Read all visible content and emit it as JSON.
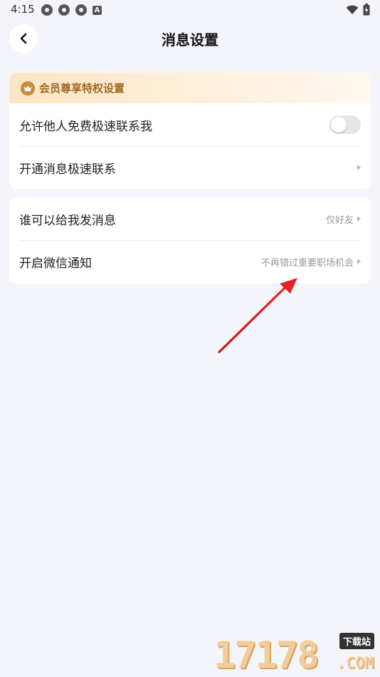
{
  "status_bar": {
    "time": "4:15",
    "left_icons": [
      "vpn-icon",
      "vpn-icon",
      "vpn-icon",
      "a-icon"
    ],
    "a_glyph": "A",
    "right_icons": [
      "wifi-icon",
      "battery-icon"
    ]
  },
  "header": {
    "title": "消息设置",
    "back_icon": "chevron-left-icon"
  },
  "vip_section": {
    "title": "会员尊享特权设置",
    "icon": "crown-icon",
    "accent_color": "#a0661f",
    "rows": [
      {
        "label": "允许他人免费极速联系我",
        "type": "toggle",
        "on": false
      },
      {
        "label": "开通消息极速联系",
        "type": "link"
      }
    ]
  },
  "message_section": {
    "rows": [
      {
        "label": "谁可以给我发消息",
        "value": "仅好友",
        "type": "link"
      },
      {
        "label": "开启微信通知",
        "value": "不再错过重要职场机会",
        "type": "link"
      }
    ]
  },
  "annotation": {
    "arrow_color": "#d81e1e"
  },
  "watermark": {
    "digits": "17178",
    "label": "下载站",
    "suffix": ".COM"
  }
}
